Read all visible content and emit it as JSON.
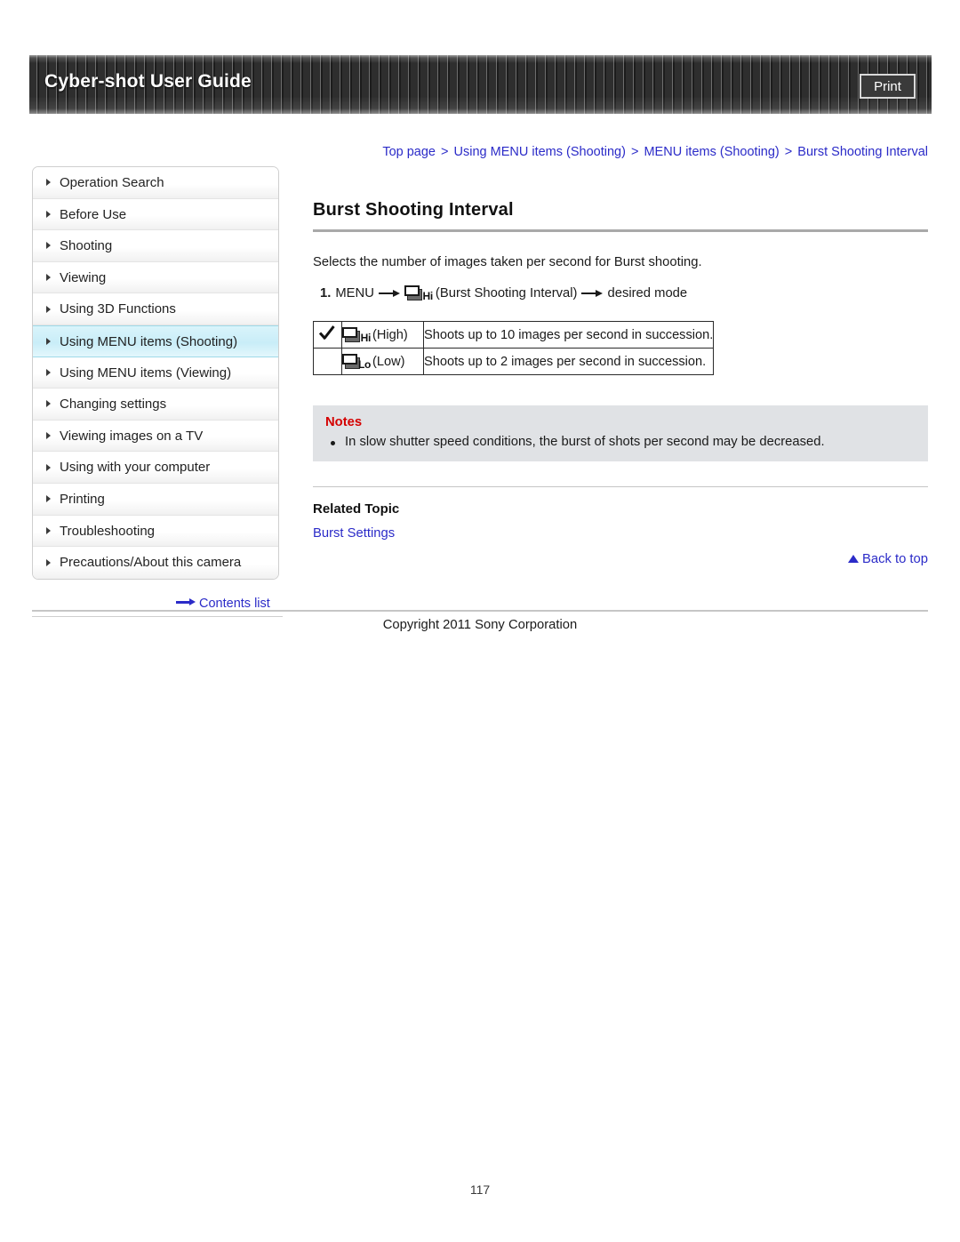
{
  "header": {
    "title": "Cyber-shot User Guide",
    "print_label": "Print"
  },
  "breadcrumb": {
    "items": [
      "Top page",
      "Using MENU items (Shooting)",
      "MENU items (Shooting)",
      "Burst Shooting Interval"
    ],
    "separator": ">"
  },
  "sidebar": {
    "items": [
      {
        "label": "Operation Search",
        "active": false
      },
      {
        "label": "Before Use",
        "active": false
      },
      {
        "label": "Shooting",
        "active": false
      },
      {
        "label": "Viewing",
        "active": false
      },
      {
        "label": "Using 3D Functions",
        "active": false
      },
      {
        "label": "Using MENU items (Shooting)",
        "active": true
      },
      {
        "label": "Using MENU items (Viewing)",
        "active": false
      },
      {
        "label": "Changing settings",
        "active": false
      },
      {
        "label": "Viewing images on a TV",
        "active": false
      },
      {
        "label": "Using with your computer",
        "active": false
      },
      {
        "label": "Printing",
        "active": false
      },
      {
        "label": "Troubleshooting",
        "active": false
      },
      {
        "label": "Precautions/About this camera",
        "active": false
      }
    ],
    "contents_list_label": "Contents list"
  },
  "main": {
    "title": "Burst Shooting Interval",
    "intro": "Selects the number of images taken per second for Burst shooting.",
    "step": {
      "number": "1.",
      "menu_label": "MENU",
      "icon_letters": "Hi",
      "icon_caption": "(Burst Shooting Interval)",
      "result": "desired mode"
    },
    "mode_table": {
      "rows": [
        {
          "selected": true,
          "icon_letters": "Hi",
          "mode_label": "(High)",
          "description": "Shoots up to 10 images per second in succession."
        },
        {
          "selected": false,
          "icon_letters": "Lo",
          "mode_label": "(Low)",
          "description": "Shoots up to 2 images per second in succession."
        }
      ]
    },
    "notes": {
      "title": "Notes",
      "items": [
        "In slow shutter speed conditions, the burst of shots per second may be decreased."
      ]
    },
    "related": {
      "title": "Related Topic",
      "links": [
        "Burst Settings"
      ]
    },
    "back_to_top_label": "Back to top"
  },
  "footer": {
    "copyright": "Copyright 2011 Sony Corporation",
    "page_number": "117"
  },
  "colors": {
    "link": "#2b2bc8",
    "notes_title": "#d40000",
    "active_nav": "#c9edf8",
    "notes_bg": "#e0e2e5"
  }
}
